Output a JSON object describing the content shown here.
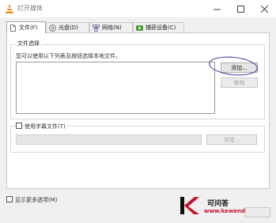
{
  "window": {
    "title": "打开媒体"
  },
  "tabs": [
    {
      "label": "文件(F)",
      "icon": "file-icon",
      "active": true
    },
    {
      "label": "光盘(D)",
      "icon": "disc-icon",
      "active": false
    },
    {
      "label": "网络(N)",
      "icon": "network-icon",
      "active": false
    },
    {
      "label": "捕获设备(C)",
      "icon": "capture-device-icon",
      "active": false
    }
  ],
  "file_selection": {
    "group_title": "文件选择",
    "hint": "您可以使用以下列表及按钮选择本地文件。",
    "add_button": "添加...",
    "remove_button": "移除"
  },
  "subtitle": {
    "checkbox_label": "使用字幕文件(T)",
    "browse_button": "浏览..."
  },
  "footer": {
    "more_options_label": "显示更多选项(M)"
  },
  "watermark": {
    "brand": "可问答",
    "url": "www.kewenda.com"
  },
  "colors": {
    "vlc_orange": "#f29000",
    "annotation_circle": "#2b2b8f",
    "watermark_red": "#c8102e"
  }
}
